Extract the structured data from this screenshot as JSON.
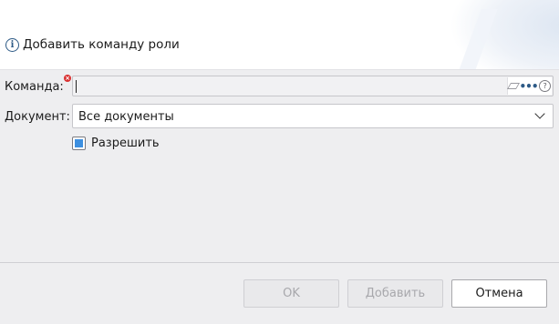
{
  "dialog": {
    "title": "Добавить команду роли",
    "info_icon": "info-icon"
  },
  "form": {
    "command_label": "Команда:",
    "command_value": "",
    "command_required": true,
    "document_label": "Документ:",
    "document_value": "Все документы",
    "allow_label": "Разрешить",
    "allow_checked": true,
    "icons": [
      "eraser-icon",
      "more-dots-icon",
      "help-icon",
      "chevron-down-icon"
    ]
  },
  "buttons": {
    "ok_label": "OK",
    "add_label": "Добавить",
    "cancel_label": "Отмена"
  },
  "colors": {
    "accent": "#3d8fe0",
    "required": "#d93030",
    "background": "#eeeef0"
  }
}
